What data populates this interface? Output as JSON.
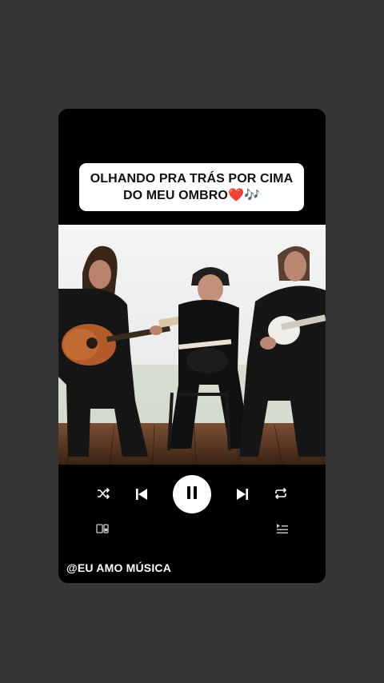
{
  "caption": {
    "text": "OLHANDO PRA TRÁS POR CIMA DO MEU OMBRO",
    "emoji": "❤️🎶"
  },
  "player": {
    "state": "playing",
    "icons": [
      "shuffle-icon",
      "previous-icon",
      "pause-icon",
      "next-icon",
      "repeat-icon",
      "connect-device-icon",
      "queue-icon"
    ]
  },
  "watermark": "@EU AMO MÚSICA",
  "colors": {
    "background": "#353535",
    "card": "#000000",
    "caption_bg": "#ffffff",
    "heart": "#e0162b"
  }
}
